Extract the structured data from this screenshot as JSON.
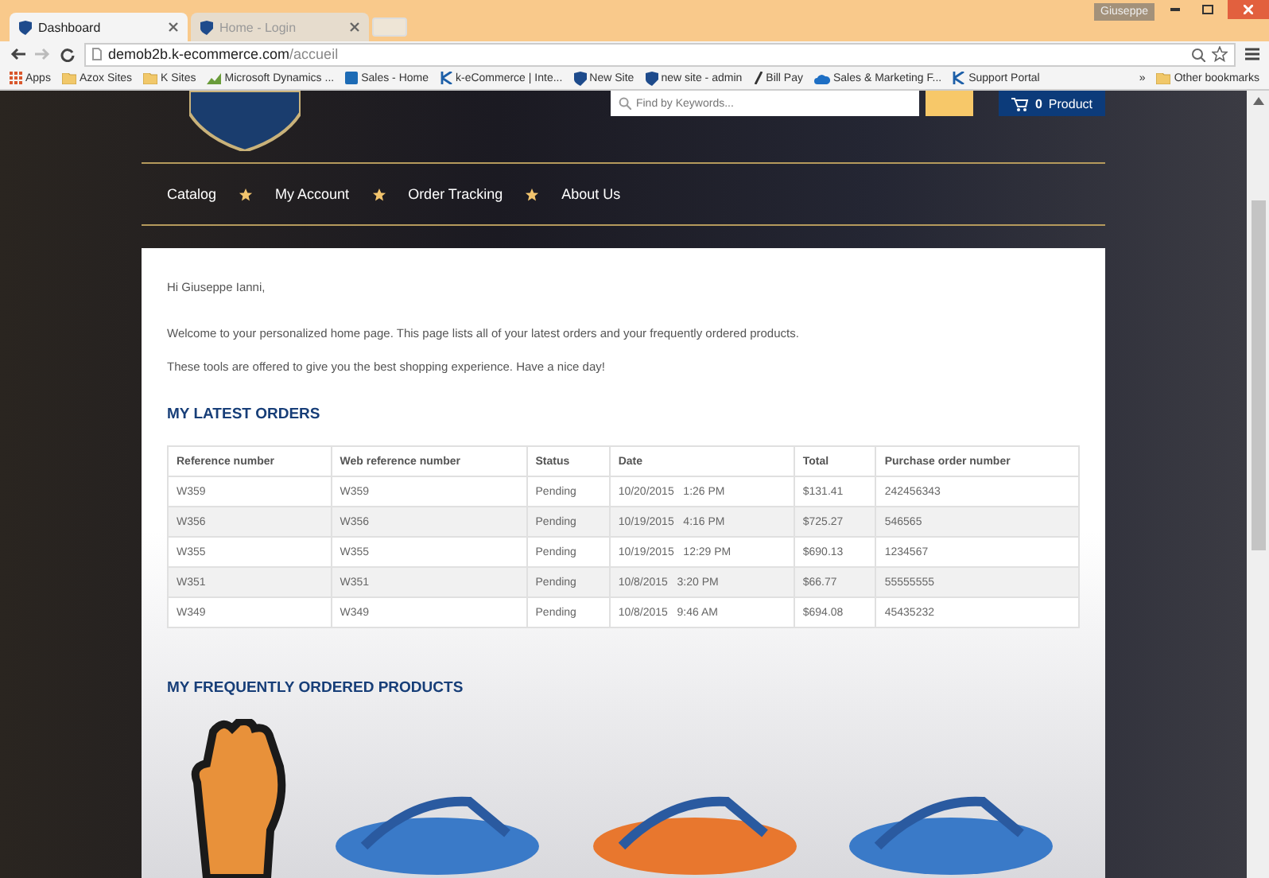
{
  "window": {
    "user": "Giuseppe"
  },
  "tabs": [
    {
      "label": "Dashboard",
      "selected": true
    },
    {
      "label": "Home - Login",
      "selected": false
    }
  ],
  "address": {
    "host": "demob2b.k-ecommerce.com",
    "path": "/accueil"
  },
  "bookmarks": [
    {
      "label": "Apps",
      "kind": "apps"
    },
    {
      "label": "Azox Sites",
      "kind": "folder"
    },
    {
      "label": "K Sites",
      "kind": "folder"
    },
    {
      "label": "Microsoft Dynamics ...",
      "kind": "chart"
    },
    {
      "label": "Sales - Home",
      "kind": "sharepoint"
    },
    {
      "label": "k-eCommerce | Inte...",
      "kind": "k"
    },
    {
      "label": "New Site",
      "kind": "shield"
    },
    {
      "label": "new site - admin",
      "kind": "shield"
    },
    {
      "label": "Bill Pay",
      "kind": "pen"
    },
    {
      "label": "Sales & Marketing F...",
      "kind": "cloud"
    },
    {
      "label": "Support Portal",
      "kind": "k"
    }
  ],
  "bookmarks_overflow": "»",
  "other_bookmarks": "Other bookmarks",
  "search": {
    "placeholder": "Find by Keywords..."
  },
  "cart": {
    "count": "0",
    "label": "Product"
  },
  "nav": [
    "Catalog",
    "My Account",
    "Order Tracking",
    "About Us"
  ],
  "greeting": "Hi Giuseppe Ianni,",
  "intro": [
    "Welcome to your personalized home page. This page lists all of your latest orders and your frequently ordered products.",
    "These tools are offered to give you the best shopping experience. Have a nice day!"
  ],
  "orders": {
    "title": "MY LATEST ORDERS",
    "columns": [
      "Reference number",
      "Web reference number",
      "Status",
      "Date",
      "Total",
      "Purchase order number"
    ],
    "rows": [
      [
        "W359",
        "W359",
        "Pending",
        "10/20/2015   1:26 PM",
        "$131.41",
        "242456343"
      ],
      [
        "W356",
        "W356",
        "Pending",
        "10/19/2015   4:16 PM",
        "$725.27",
        "546565"
      ],
      [
        "W355",
        "W355",
        "Pending",
        "10/19/2015   12:29 PM",
        "$690.13",
        "1234567"
      ],
      [
        "W351",
        "W351",
        "Pending",
        "10/8/2015   3:20 PM",
        "$66.77",
        "55555555"
      ],
      [
        "W349",
        "W349",
        "Pending",
        "10/8/2015   9:46 AM",
        "$694.08",
        "45435232"
      ]
    ]
  },
  "products": {
    "title": "MY FREQUENTLY ORDERED PRODUCTS",
    "items": [
      {
        "kind": "glove",
        "color": "#e8913a"
      },
      {
        "kind": "sandal",
        "color": "#3a7ac8"
      },
      {
        "kind": "sandal",
        "color": "#e8772e"
      },
      {
        "kind": "sandal",
        "color": "#3a7ac8"
      }
    ]
  }
}
